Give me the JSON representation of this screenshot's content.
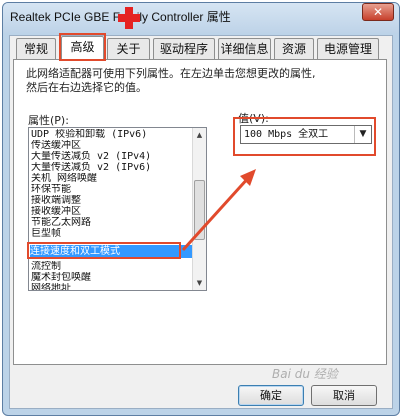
{
  "window": {
    "title": "Realtek PCIe GBE Family Controller 属性",
    "close_label": "✕"
  },
  "tabs": [
    {
      "label": "常规"
    },
    {
      "label": "高级"
    },
    {
      "label": "关于"
    },
    {
      "label": "驱动程序"
    },
    {
      "label": "详细信息"
    },
    {
      "label": "资源"
    },
    {
      "label": "电源管理"
    }
  ],
  "selected_tab": "高级",
  "advanced": {
    "description_line1": "此网络适配器可使用下列属性。在左边单击您想更改的属性,",
    "description_line2": "然后在右边选择它的值。",
    "property_label": "属性(P):",
    "value_label": "值(V):",
    "properties": [
      "UDP 校验和卸载 (IPv6)",
      "传送缓冲区",
      "大量传送减负 v2 (IPv4)",
      "大量传送减负 v2 (IPv6)",
      "关机 网络唤醒",
      "环保节能",
      "接收端调整",
      "接收缓冲区",
      "节能乙太网路",
      "巨型帧",
      "连接速度和双工模式",
      "流控制",
      "魔术封包唤醒",
      "网络地址"
    ],
    "selected_property": "连接速度和双工模式",
    "selected_value": "100 Mbps 全双工"
  },
  "buttons": {
    "ok": "确定",
    "cancel": "取消"
  },
  "watermark": "Bai du 经验",
  "colors": {
    "annotation_red": "#e14a2c",
    "selection_blue": "#3399ff"
  }
}
